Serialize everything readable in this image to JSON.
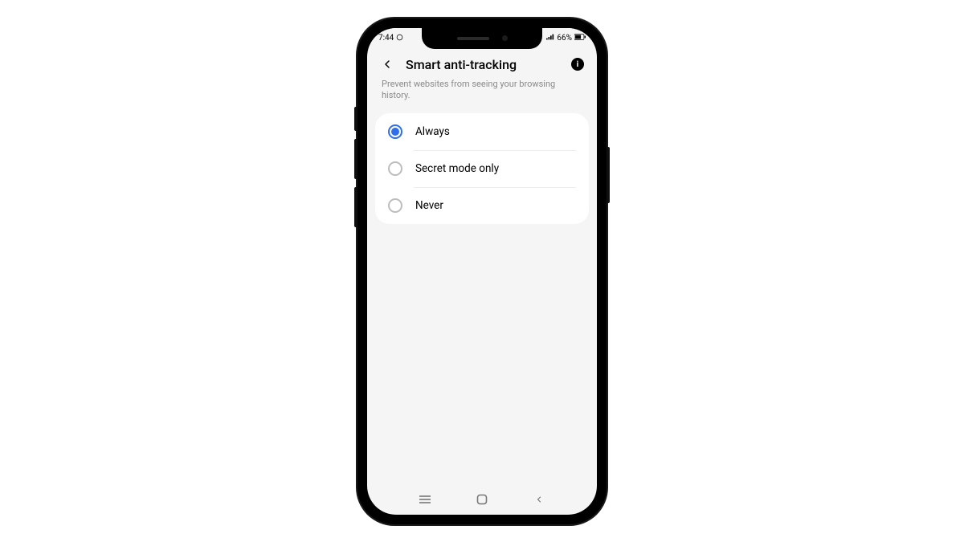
{
  "status": {
    "time": "7:44",
    "battery": "66%"
  },
  "header": {
    "title": "Smart anti-tracking"
  },
  "description": "Prevent websites from seeing your browsing history.",
  "options": [
    {
      "label": "Always",
      "selected": true
    },
    {
      "label": "Secret mode only",
      "selected": false
    },
    {
      "label": "Never",
      "selected": false
    }
  ]
}
